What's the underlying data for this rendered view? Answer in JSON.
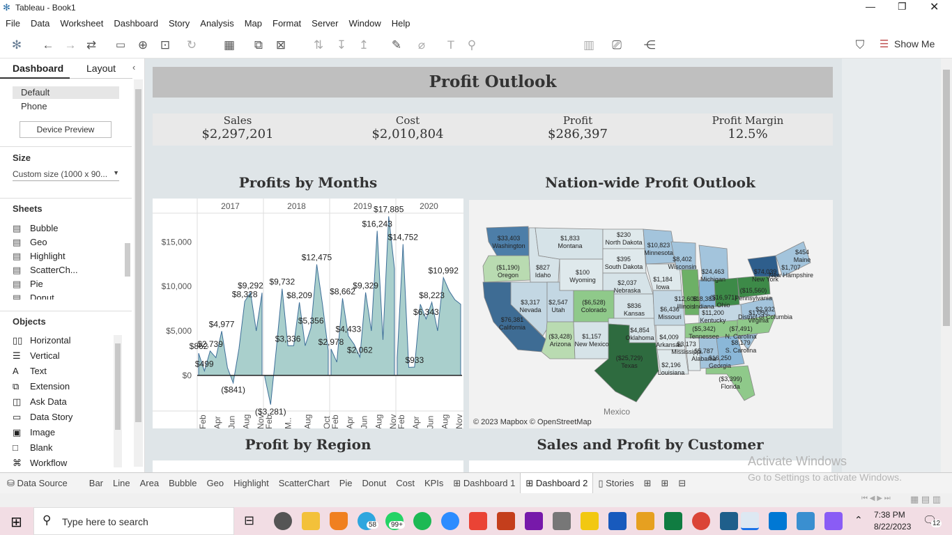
{
  "window": {
    "title": "Tableau - Book1"
  },
  "menu": [
    "File",
    "Data",
    "Worksheet",
    "Dashboard",
    "Story",
    "Analysis",
    "Map",
    "Format",
    "Server",
    "Window",
    "Help"
  ],
  "toolbar": {
    "show_me": "Show Me"
  },
  "left_pane": {
    "tabs": [
      "Dashboard",
      "Layout"
    ],
    "devices": [
      "Default",
      "Phone"
    ],
    "device_preview": "Device Preview",
    "size_header": "Size",
    "size_value": "Custom size (1000 x 90...",
    "sheets_header": "Sheets",
    "sheets": [
      "Bubble",
      "Geo",
      "Highlight",
      "ScatterCh...",
      "Pie",
      "Donut"
    ],
    "objects_header": "Objects",
    "objects": [
      "Horizontal",
      "Vertical",
      "Text",
      "Extension",
      "Ask Data",
      "Data Story",
      "Image",
      "Blank",
      "Workflow"
    ]
  },
  "dashboard": {
    "title": "Profit Outlook",
    "kpis": [
      {
        "label": "Sales",
        "value": "$2,297,201"
      },
      {
        "label": "Cost",
        "value": "$2,010,804"
      },
      {
        "label": "Profit",
        "value": "$286,397"
      },
      {
        "label": "Profit Margin",
        "value": "12.5%"
      }
    ],
    "chart_titles": [
      "Profits by Months",
      "Nation-wide Profit Outlook",
      "Profit by Region",
      "Sales and Profit by Customer"
    ],
    "map_attribution": "© 2023 Mapbox © OpenStreetMap",
    "map_mexico": "Mexico"
  },
  "chart_data": {
    "type": "area",
    "years": [
      "2017",
      "2018",
      "2019",
      "2020"
    ],
    "y_ticks": [
      "$15,000",
      "$10,000",
      "$5,000",
      "$0"
    ],
    "ylim": [
      -4000,
      18000
    ],
    "x_tick_labels": [
      [
        "Feb",
        "Apr",
        "Jun",
        "Aug",
        "Nov"
      ],
      [
        "Feb",
        "M..",
        "Aug",
        "Oct"
      ],
      [
        "Feb",
        "Apr",
        "Jun",
        "Aug",
        "Nov"
      ],
      [
        "Feb",
        "Apr",
        "Jun",
        "Aug",
        "Nov"
      ]
    ],
    "series": [
      {
        "year": "2017",
        "values": [
          2500,
          499,
          2739,
          2000,
          4977,
          862,
          -841,
          3000,
          8328,
          9292,
          5000,
          9292
        ]
      },
      {
        "year": "2018",
        "values": [
          -200,
          -3281,
          3000,
          9732,
          3336,
          3336,
          8209,
          3336,
          5356,
          12475,
          8000,
          2800
        ]
      },
      {
        "year": "2019",
        "values": [
          2978,
          1500,
          8662,
          4433,
          3500,
          2062,
          9329,
          5000,
          16243,
          4000,
          17885,
          12000
        ]
      },
      {
        "year": "2020",
        "values": [
          2000,
          14752,
          900,
          933,
          8000,
          6343,
          8223,
          5000,
          10992,
          9500,
          8500,
          8000
        ]
      }
    ],
    "data_labels": [
      "$862",
      "$499",
      "($841)",
      "$4,977",
      "$2,739",
      "$8,328",
      "$9,292",
      "$9,732",
      "$8,209",
      "($3,281)",
      "$3,336",
      "$5,356",
      "$12,475",
      "$8,662",
      "$2,978",
      "$4,433",
      "$2,062",
      "$9,329",
      "$16,243",
      "$17,885",
      "$14,752",
      "$933",
      "$6,343",
      "$8,223",
      "$10,992"
    ]
  },
  "map_labels": [
    {
      "v": "$33,403",
      "n": "Washington"
    },
    {
      "v": "$1,833",
      "n": "Montana"
    },
    {
      "v": "$230",
      "n": "North Dakota"
    },
    {
      "v": "$10,823",
      "n": "Minnesota"
    },
    {
      "v": "($1,190)",
      "n": "Oregon"
    },
    {
      "v": "$827",
      "n": "Idaho"
    },
    {
      "v": "$100",
      "n": "Wyoming"
    },
    {
      "v": "$395",
      "n": "South Dakota"
    },
    {
      "v": "$8,402",
      "n": "Wisconsin"
    },
    {
      "v": "$24,463",
      "n": "Michigan"
    },
    {
      "v": "$2,037",
      "n": "Nebraska"
    },
    {
      "v": "$1,184",
      "n": "Iowa"
    },
    {
      "v": "$3,317",
      "n": "Nevada"
    },
    {
      "v": "$2,547",
      "n": "Utah"
    },
    {
      "v": "($6,528)",
      "n": "Colorado"
    },
    {
      "v": "$836",
      "n": "Kansas"
    },
    {
      "v": "$6,436",
      "n": "Missouri"
    },
    {
      "v": "$76,381",
      "n": "California"
    },
    {
      "v": "($3,428)",
      "n": "Arizona"
    },
    {
      "v": "$1,157",
      "n": "New Mexico"
    },
    {
      "v": "$4,854",
      "n": "Oklahoma"
    },
    {
      "v": "$4,009",
      "n": "Arkansas"
    },
    {
      "v": "($25,729)",
      "n": "Texas"
    },
    {
      "v": "$2,196",
      "n": "Louisiana"
    },
    {
      "v": "($3,399)",
      "n": "Florida"
    },
    {
      "v": "$74,039",
      "n": "New York"
    },
    {
      "v": "$1,707",
      "n": "New Hampshire"
    },
    {
      "v": "$454",
      "n": "Maine"
    },
    {
      "v": "($15,560)",
      "n": "Pennsylvania"
    },
    {
      "v": "($16,971)",
      "n": "Ohio"
    },
    {
      "v": "$18,383",
      "n": "Indiana"
    },
    {
      "v": "$12,608",
      "n": "Illinois"
    },
    {
      "v": "$11,200",
      "n": "Kentucky"
    },
    {
      "v": "($5,342)",
      "n": "Tennessee"
    },
    {
      "v": "($7,491)",
      "n": "N. Carolina"
    },
    {
      "v": "$1,050",
      "n": "Virginia"
    },
    {
      "v": "$3,173",
      "n": "Mississippi"
    },
    {
      "v": "$5,787",
      "n": "Alabama"
    },
    {
      "v": "$16,250",
      "n": "Georgia"
    },
    {
      "v": "$8,179",
      "n": "S. Carolina"
    },
    {
      "v": "$2,932",
      "n": "District of Columbia"
    }
  ],
  "sheet_tabs": [
    "Data Source",
    "Bar",
    "Line",
    "Area",
    "Bubble",
    "Geo",
    "Highlight",
    "ScatterChart",
    "Pie",
    "Donut",
    "Cost",
    "KPIs",
    "Dashboard 1",
    "Dashboard 2",
    "Stories"
  ],
  "watermark": {
    "line1": "Activate Windows",
    "line2": "Go to Settings to activate Windows."
  },
  "taskbar": {
    "search_placeholder": "Type here to search",
    "time": "7:38 PM",
    "date": "8/22/2023",
    "badge1": "58",
    "badge2": "99+",
    "notif": "12"
  }
}
